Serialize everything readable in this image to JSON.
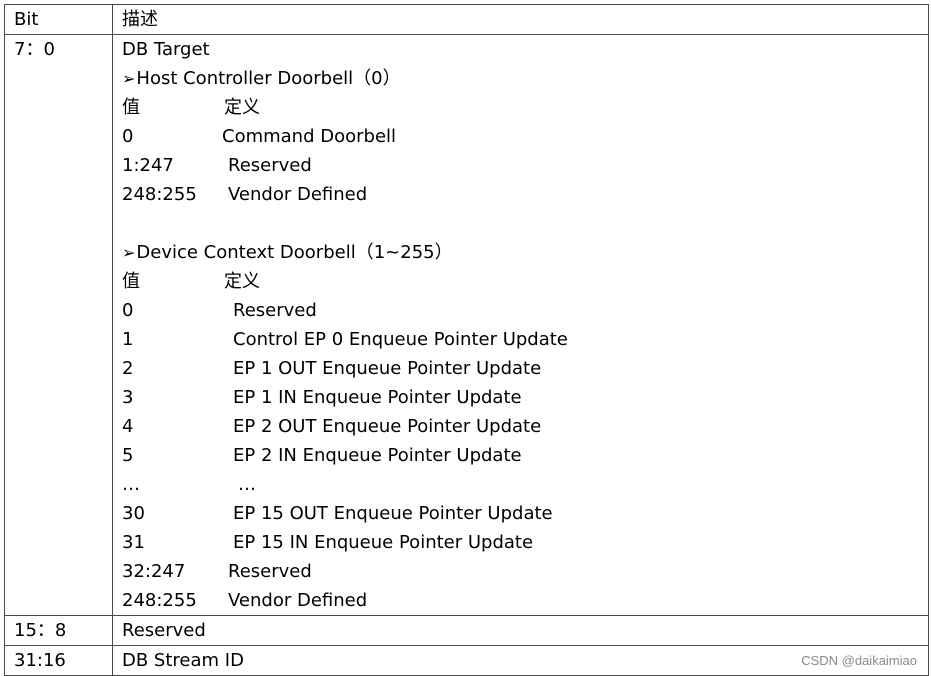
{
  "header": {
    "bit": "Bit",
    "desc": "描述"
  },
  "rows": [
    {
      "bit": "7：0"
    },
    {
      "bit": "15：8",
      "desc": "Reserved"
    },
    {
      "bit": "31:16",
      "desc": "DB Stream ID"
    }
  ],
  "target": {
    "title": "DB Target",
    "arrow_glyph": "➢",
    "host": {
      "heading": "Host Controller Doorbell（0）",
      "col_value": "值",
      "col_def": "定义",
      "entries": [
        {
          "k": "0",
          "v": "Command Doorbell"
        },
        {
          "k": "1:247",
          "v": "Reserved"
        },
        {
          "k": "248:255",
          "v": "Vendor Defined"
        }
      ]
    },
    "device": {
      "heading": "Device Context Doorbell（1~255）",
      "col_value": "值",
      "col_def": "定义",
      "entries": [
        {
          "k": "0",
          "v": "Reserved"
        },
        {
          "k": "1",
          "v": "Control EP 0 Enqueue Pointer Update"
        },
        {
          "k": "2",
          "v": "EP 1 OUT Enqueue Pointer Update"
        },
        {
          "k": "3",
          "v": "EP 1 IN Enqueue Pointer Update"
        },
        {
          "k": "4",
          "v": "EP 2 OUT Enqueue Pointer Update"
        },
        {
          "k": "5",
          "v": "EP 2 IN Enqueue Pointer Update"
        },
        {
          "k": "…",
          "v": "…"
        },
        {
          "k": "30",
          "v": "EP 15 OUT Enqueue Pointer Update"
        },
        {
          "k": "31",
          "v": "EP 15 IN Enqueue Pointer Update"
        },
        {
          "k": "32:247",
          "v": "Reserved"
        },
        {
          "k": "248:255",
          "v": "Vendor Defined"
        }
      ]
    }
  },
  "watermark": "CSDN @daikaimiao"
}
